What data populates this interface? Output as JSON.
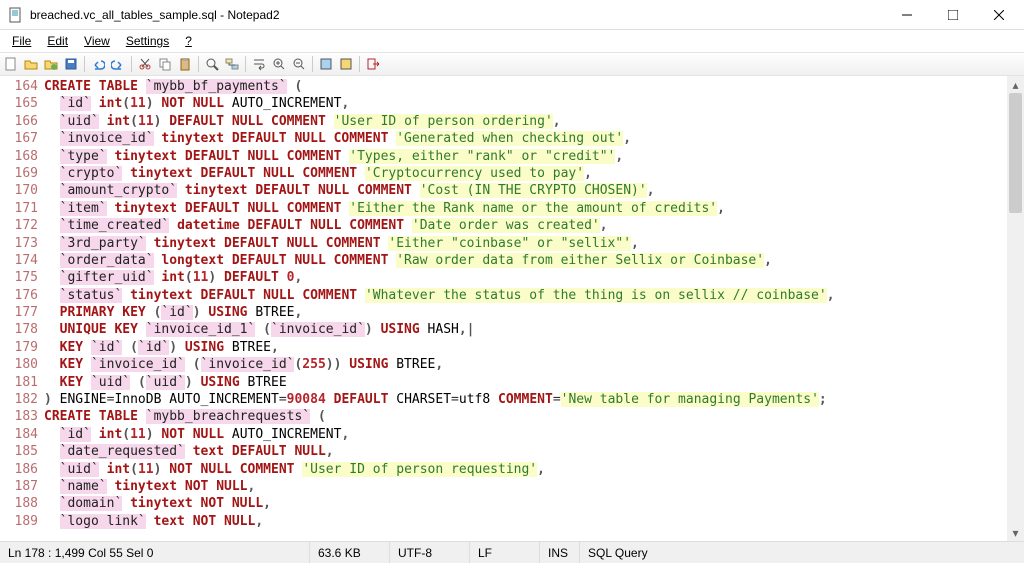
{
  "window": {
    "title": "breached.vc_all_tables_sample.sql - Notepad2"
  },
  "menu": {
    "file": "File",
    "edit": "Edit",
    "view": "View",
    "settings": "Settings",
    "help": "?"
  },
  "toolbar": {
    "new": "new",
    "open": "open",
    "openfolder": "openfolder",
    "save": "save",
    "undo": "undo",
    "redo": "redo",
    "cut": "cut",
    "copy": "copy",
    "paste": "paste",
    "find": "find",
    "replace": "replace",
    "wordwrap": "wordwrap",
    "zoomin": "zoomin",
    "zoomout": "zoomout",
    "scheme": "scheme",
    "scheme2": "scheme2",
    "exit": "exit"
  },
  "status": {
    "pos": "Ln 178 : 1,499   Col 55   Sel 0",
    "size": "63.6 KB",
    "encoding": "UTF-8",
    "eol": "LF",
    "ovr": "INS",
    "lexer": "SQL Query"
  },
  "code": {
    "first_line": 164,
    "lines": [
      {
        "n": 164,
        "seg": [
          [
            "kw",
            "CREATE TABLE"
          ],
          [
            "",
            ""
          ],
          [
            "",
            " "
          ],
          [
            "ident",
            "`mybb_bf_payments`"
          ],
          [
            "",
            " "
          ],
          [
            "punc",
            "("
          ]
        ]
      },
      {
        "n": 165,
        "seg": [
          [
            "",
            "  "
          ],
          [
            "ident",
            "`id`"
          ],
          [
            "",
            " "
          ],
          [
            "kw",
            "int"
          ],
          [
            "punc",
            "("
          ],
          [
            "num",
            "11"
          ],
          [
            "punc",
            ")"
          ],
          [
            "",
            " "
          ],
          [
            "kw",
            "NOT NULL"
          ],
          [
            "",
            " AUTO_INCREMENT"
          ],
          [
            "punc",
            ","
          ]
        ]
      },
      {
        "n": 166,
        "seg": [
          [
            "",
            "  "
          ],
          [
            "ident",
            "`uid`"
          ],
          [
            "",
            " "
          ],
          [
            "kw",
            "int"
          ],
          [
            "punc",
            "("
          ],
          [
            "num",
            "11"
          ],
          [
            "punc",
            ")"
          ],
          [
            "",
            " "
          ],
          [
            "kw",
            "DEFAULT NULL"
          ],
          [
            "",
            " "
          ],
          [
            "kw",
            "COMMENT"
          ],
          [
            "",
            " "
          ],
          [
            "str",
            "'User ID of person ordering'"
          ],
          [
            "punc",
            ","
          ]
        ]
      },
      {
        "n": 167,
        "seg": [
          [
            "",
            "  "
          ],
          [
            "ident",
            "`invoice_id`"
          ],
          [
            "",
            " "
          ],
          [
            "kw",
            "tinytext DEFAULT NULL"
          ],
          [
            "",
            " "
          ],
          [
            "kw",
            "COMMENT"
          ],
          [
            "",
            " "
          ],
          [
            "str",
            "'Generated when checking out'"
          ],
          [
            "punc",
            ","
          ]
        ]
      },
      {
        "n": 168,
        "seg": [
          [
            "",
            "  "
          ],
          [
            "ident",
            "`type`"
          ],
          [
            "",
            " "
          ],
          [
            "kw",
            "tinytext DEFAULT NULL"
          ],
          [
            "",
            " "
          ],
          [
            "kw",
            "COMMENT"
          ],
          [
            "",
            " "
          ],
          [
            "str",
            "'Types, either \"rank\" or \"credit\"'"
          ],
          [
            "punc",
            ","
          ]
        ]
      },
      {
        "n": 169,
        "seg": [
          [
            "",
            "  "
          ],
          [
            "ident",
            "`crypto`"
          ],
          [
            "",
            " "
          ],
          [
            "kw",
            "tinytext DEFAULT NULL"
          ],
          [
            "",
            " "
          ],
          [
            "kw",
            "COMMENT"
          ],
          [
            "",
            " "
          ],
          [
            "str",
            "'Cryptocurrency used to pay'"
          ],
          [
            "punc",
            ","
          ]
        ]
      },
      {
        "n": 170,
        "seg": [
          [
            "",
            "  "
          ],
          [
            "ident",
            "`amount_crypto`"
          ],
          [
            "",
            " "
          ],
          [
            "kw",
            "tinytext DEFAULT NULL"
          ],
          [
            "",
            " "
          ],
          [
            "kw",
            "COMMENT"
          ],
          [
            "",
            " "
          ],
          [
            "str",
            "'Cost (IN THE CRYPTO CHOSEN)'"
          ],
          [
            "punc",
            ","
          ]
        ]
      },
      {
        "n": 171,
        "seg": [
          [
            "",
            "  "
          ],
          [
            "ident",
            "`item`"
          ],
          [
            "",
            " "
          ],
          [
            "kw",
            "tinytext DEFAULT NULL"
          ],
          [
            "",
            " "
          ],
          [
            "kw",
            "COMMENT"
          ],
          [
            "",
            " "
          ],
          [
            "str",
            "'Either the Rank name or the amount of credits'"
          ],
          [
            "punc",
            ","
          ]
        ]
      },
      {
        "n": 172,
        "seg": [
          [
            "",
            "  "
          ],
          [
            "ident",
            "`time_created`"
          ],
          [
            "",
            " "
          ],
          [
            "kw",
            "datetime DEFAULT NULL"
          ],
          [
            "",
            " "
          ],
          [
            "kw",
            "COMMENT"
          ],
          [
            "",
            " "
          ],
          [
            "str",
            "'Date order was created'"
          ],
          [
            "punc",
            ","
          ]
        ]
      },
      {
        "n": 173,
        "seg": [
          [
            "",
            "  "
          ],
          [
            "ident",
            "`3rd_party`"
          ],
          [
            "",
            " "
          ],
          [
            "kw",
            "tinytext DEFAULT NULL"
          ],
          [
            "",
            " "
          ],
          [
            "kw",
            "COMMENT"
          ],
          [
            "",
            " "
          ],
          [
            "str",
            "'Either \"coinbase\" or \"sellix\"'"
          ],
          [
            "punc",
            ","
          ]
        ]
      },
      {
        "n": 174,
        "seg": [
          [
            "",
            "  "
          ],
          [
            "ident",
            "`order_data`"
          ],
          [
            "",
            " "
          ],
          [
            "kw",
            "longtext DEFAULT NULL"
          ],
          [
            "",
            " "
          ],
          [
            "kw",
            "COMMENT"
          ],
          [
            "",
            " "
          ],
          [
            "str",
            "'Raw order data from either Sellix or Coinbase'"
          ],
          [
            "punc",
            ","
          ]
        ]
      },
      {
        "n": 175,
        "seg": [
          [
            "",
            "  "
          ],
          [
            "ident",
            "`gifter_uid`"
          ],
          [
            "",
            " "
          ],
          [
            "kw",
            "int"
          ],
          [
            "punc",
            "("
          ],
          [
            "num",
            "11"
          ],
          [
            "punc",
            ")"
          ],
          [
            "",
            " "
          ],
          [
            "kw",
            "DEFAULT"
          ],
          [
            "",
            " "
          ],
          [
            "num",
            "0"
          ],
          [
            "punc",
            ","
          ]
        ]
      },
      {
        "n": 176,
        "seg": [
          [
            "",
            "  "
          ],
          [
            "ident",
            "`status`"
          ],
          [
            "",
            " "
          ],
          [
            "kw",
            "tinytext DEFAULT NULL"
          ],
          [
            "",
            " "
          ],
          [
            "kw",
            "COMMENT"
          ],
          [
            "",
            " "
          ],
          [
            "str",
            "'Whatever the status of the thing is on sellix // coinbase'"
          ],
          [
            "punc",
            ","
          ]
        ]
      },
      {
        "n": 177,
        "seg": [
          [
            "",
            "  "
          ],
          [
            "kw",
            "PRIMARY KEY"
          ],
          [
            "",
            " "
          ],
          [
            "punc",
            "("
          ],
          [
            "ident",
            "`id`"
          ],
          [
            "punc",
            ")"
          ],
          [
            "",
            " "
          ],
          [
            "kw",
            "USING"
          ],
          [
            "",
            " BTREE"
          ],
          [
            "punc",
            ","
          ]
        ]
      },
      {
        "n": 178,
        "seg": [
          [
            "",
            "  "
          ],
          [
            "kw",
            "UNIQUE KEY"
          ],
          [
            "",
            " "
          ],
          [
            "ident",
            "`invoice_id_1`"
          ],
          [
            "",
            " "
          ],
          [
            "punc",
            "("
          ],
          [
            "ident",
            "`invoice_id`"
          ],
          [
            "punc",
            ")"
          ],
          [
            "",
            " "
          ],
          [
            "kw",
            "USING"
          ],
          [
            "",
            " HASH"
          ],
          [
            "punc",
            ",|"
          ]
        ]
      },
      {
        "n": 179,
        "seg": [
          [
            "",
            "  "
          ],
          [
            "kw",
            "KEY"
          ],
          [
            "",
            " "
          ],
          [
            "ident",
            "`id`"
          ],
          [
            "",
            " "
          ],
          [
            "punc",
            "("
          ],
          [
            "ident",
            "`id`"
          ],
          [
            "punc",
            ")"
          ],
          [
            "",
            " "
          ],
          [
            "kw",
            "USING"
          ],
          [
            "",
            " BTREE"
          ],
          [
            "punc",
            ","
          ]
        ]
      },
      {
        "n": 180,
        "seg": [
          [
            "",
            "  "
          ],
          [
            "kw",
            "KEY"
          ],
          [
            "",
            " "
          ],
          [
            "ident",
            "`invoice_id`"
          ],
          [
            "",
            " "
          ],
          [
            "punc",
            "("
          ],
          [
            "ident",
            "`invoice_id`"
          ],
          [
            "punc",
            "("
          ],
          [
            "num",
            "255"
          ],
          [
            "punc",
            "))"
          ],
          [
            "",
            " "
          ],
          [
            "kw",
            "USING"
          ],
          [
            "",
            " BTREE"
          ],
          [
            "punc",
            ","
          ]
        ]
      },
      {
        "n": 181,
        "seg": [
          [
            "",
            "  "
          ],
          [
            "kw",
            "KEY"
          ],
          [
            "",
            " "
          ],
          [
            "ident",
            "`uid`"
          ],
          [
            "",
            " "
          ],
          [
            "punc",
            "("
          ],
          [
            "ident",
            "`uid`"
          ],
          [
            "punc",
            ")"
          ],
          [
            "",
            " "
          ],
          [
            "kw",
            "USING"
          ],
          [
            "",
            " BTREE"
          ]
        ]
      },
      {
        "n": 182,
        "seg": [
          [
            "punc",
            ")"
          ],
          [
            "",
            " ENGINE"
          ],
          [
            "op",
            "="
          ],
          [
            "",
            "InnoDB AUTO_INCREMENT"
          ],
          [
            "op",
            "="
          ],
          [
            "num",
            "90084"
          ],
          [
            "",
            " "
          ],
          [
            "kw",
            "DEFAULT"
          ],
          [
            "",
            " CHARSET"
          ],
          [
            "op",
            "="
          ],
          [
            "",
            "utf8 "
          ],
          [
            "kw",
            "COMMENT"
          ],
          [
            "op",
            "="
          ],
          [
            "str",
            "'New table for managing Payments'"
          ],
          [
            "punc",
            ";"
          ]
        ]
      },
      {
        "n": 183,
        "seg": [
          [
            "kw",
            "CREATE TABLE"
          ],
          [
            "",
            " "
          ],
          [
            "ident",
            "`mybb_breachrequests`"
          ],
          [
            "",
            " "
          ],
          [
            "punc",
            "("
          ]
        ]
      },
      {
        "n": 184,
        "seg": [
          [
            "",
            "  "
          ],
          [
            "ident",
            "`id`"
          ],
          [
            "",
            " "
          ],
          [
            "kw",
            "int"
          ],
          [
            "punc",
            "("
          ],
          [
            "num",
            "11"
          ],
          [
            "punc",
            ")"
          ],
          [
            "",
            " "
          ],
          [
            "kw",
            "NOT NULL"
          ],
          [
            "",
            " AUTO_INCREMENT"
          ],
          [
            "punc",
            ","
          ]
        ]
      },
      {
        "n": 185,
        "seg": [
          [
            "",
            "  "
          ],
          [
            "ident",
            "`date_requested`"
          ],
          [
            "",
            " "
          ],
          [
            "kw",
            "text DEFAULT NULL"
          ],
          [
            "punc",
            ","
          ]
        ]
      },
      {
        "n": 186,
        "seg": [
          [
            "",
            "  "
          ],
          [
            "ident",
            "`uid`"
          ],
          [
            "",
            " "
          ],
          [
            "kw",
            "int"
          ],
          [
            "punc",
            "("
          ],
          [
            "num",
            "11"
          ],
          [
            "punc",
            ")"
          ],
          [
            "",
            " "
          ],
          [
            "kw",
            "NOT NULL"
          ],
          [
            "",
            " "
          ],
          [
            "kw",
            "COMMENT"
          ],
          [
            "",
            " "
          ],
          [
            "str",
            "'User ID of person requesting'"
          ],
          [
            "punc",
            ","
          ]
        ]
      },
      {
        "n": 187,
        "seg": [
          [
            "",
            "  "
          ],
          [
            "ident",
            "`name`"
          ],
          [
            "",
            " "
          ],
          [
            "kw",
            "tinytext NOT NULL"
          ],
          [
            "punc",
            ","
          ]
        ]
      },
      {
        "n": 188,
        "seg": [
          [
            "",
            "  "
          ],
          [
            "ident",
            "`domain`"
          ],
          [
            "",
            " "
          ],
          [
            "kw",
            "tinytext NOT NULL"
          ],
          [
            "punc",
            ","
          ]
        ]
      },
      {
        "n": 189,
        "seg": [
          [
            "",
            "  "
          ],
          [
            "ident",
            "`logo link`"
          ],
          [
            "",
            " "
          ],
          [
            "kw",
            "text NOT NULL"
          ],
          [
            "punc",
            ","
          ]
        ]
      }
    ]
  }
}
